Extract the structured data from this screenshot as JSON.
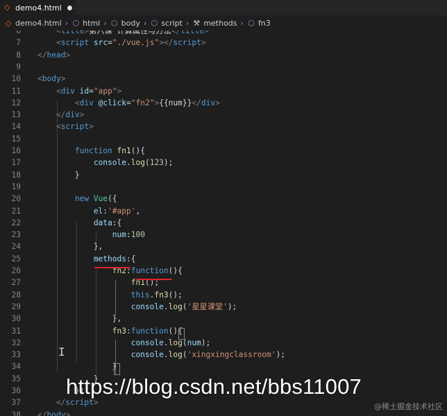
{
  "tab": {
    "filename": "demo4.html",
    "icon": "html-file-icon",
    "unsaved": true
  },
  "breadcrumb": [
    {
      "label": "demo4.html",
      "icon": "html-file-icon"
    },
    {
      "label": "html",
      "icon": "element-icon"
    },
    {
      "label": "body",
      "icon": "element-icon"
    },
    {
      "label": "script",
      "icon": "element-icon"
    },
    {
      "label": "methods",
      "icon": "wrench-icon"
    },
    {
      "label": "fn3",
      "icon": "element-icon"
    }
  ],
  "lines": [
    {
      "n": "6",
      "segs": [
        [
          "t-br",
          "    <"
        ],
        [
          "t-tag",
          "title"
        ],
        [
          "t-br",
          ">"
        ],
        [
          "t-plain",
          "第六课 计算属性与方法"
        ],
        [
          "t-br",
          "</"
        ],
        [
          "t-tag",
          "title"
        ],
        [
          "t-br",
          ">"
        ]
      ]
    },
    {
      "n": "7",
      "segs": [
        [
          "t-br",
          "    <"
        ],
        [
          "t-tag",
          "script"
        ],
        [
          "t-plain",
          " "
        ],
        [
          "t-attr",
          "src"
        ],
        [
          "t-plain",
          "="
        ],
        [
          "t-str",
          "\"./vue.js\""
        ],
        [
          "t-br",
          "></"
        ],
        [
          "t-tag",
          "script"
        ],
        [
          "t-br",
          ">"
        ]
      ]
    },
    {
      "n": "8",
      "segs": [
        [
          "t-br",
          "</"
        ],
        [
          "t-tag",
          "head"
        ],
        [
          "t-br",
          ">"
        ]
      ]
    },
    {
      "n": "9",
      "segs": []
    },
    {
      "n": "10",
      "segs": [
        [
          "t-br",
          "<"
        ],
        [
          "t-tag",
          "body"
        ],
        [
          "t-br",
          ">"
        ]
      ]
    },
    {
      "n": "11",
      "segs": [
        [
          "t-br",
          "    <"
        ],
        [
          "t-tag",
          "div"
        ],
        [
          "t-plain",
          " "
        ],
        [
          "t-attr",
          "id"
        ],
        [
          "t-plain",
          "="
        ],
        [
          "t-str",
          "\"app\""
        ],
        [
          "t-br",
          ">"
        ]
      ]
    },
    {
      "n": "12",
      "segs": [
        [
          "t-br",
          "        <"
        ],
        [
          "t-tag",
          "div"
        ],
        [
          "t-plain",
          " "
        ],
        [
          "t-attr",
          "@click"
        ],
        [
          "t-plain",
          "="
        ],
        [
          "t-str",
          "\"fn2\""
        ],
        [
          "t-br",
          ">"
        ],
        [
          "t-plain",
          "{{num}}"
        ],
        [
          "t-br",
          "</"
        ],
        [
          "t-tag",
          "div"
        ],
        [
          "t-br",
          ">"
        ]
      ]
    },
    {
      "n": "13",
      "segs": [
        [
          "t-br",
          "    </"
        ],
        [
          "t-tag",
          "div"
        ],
        [
          "t-br",
          ">"
        ]
      ]
    },
    {
      "n": "14",
      "segs": [
        [
          "t-br",
          "    <"
        ],
        [
          "t-tag",
          "script"
        ],
        [
          "t-br",
          ">"
        ]
      ]
    },
    {
      "n": "15",
      "segs": []
    },
    {
      "n": "16",
      "segs": [
        [
          "t-kw",
          "        function"
        ],
        [
          "t-plain",
          " "
        ],
        [
          "t-fn",
          "fn1"
        ],
        [
          "t-plain",
          "(){"
        ]
      ]
    },
    {
      "n": "17",
      "segs": [
        [
          "t-prop",
          "            console"
        ],
        [
          "t-plain",
          "."
        ],
        [
          "t-fn",
          "log"
        ],
        [
          "t-plain",
          "("
        ],
        [
          "t-num",
          "123"
        ],
        [
          "t-plain",
          ");"
        ]
      ]
    },
    {
      "n": "18",
      "segs": [
        [
          "t-plain",
          "        }"
        ]
      ]
    },
    {
      "n": "19",
      "segs": []
    },
    {
      "n": "20",
      "segs": [
        [
          "t-kw",
          "        new"
        ],
        [
          "t-plain",
          " "
        ],
        [
          "t-cls",
          "Vue"
        ],
        [
          "t-plain",
          "({"
        ]
      ]
    },
    {
      "n": "21",
      "segs": [
        [
          "t-prop",
          "            el"
        ],
        [
          "t-plain",
          ":"
        ],
        [
          "t-str",
          "'#app'"
        ],
        [
          "t-plain",
          ","
        ]
      ]
    },
    {
      "n": "22",
      "segs": [
        [
          "t-prop",
          "            data"
        ],
        [
          "t-plain",
          ":{"
        ]
      ]
    },
    {
      "n": "23",
      "segs": [
        [
          "t-prop",
          "                num"
        ],
        [
          "t-plain",
          ":"
        ],
        [
          "t-num",
          "100"
        ]
      ]
    },
    {
      "n": "24",
      "segs": [
        [
          "t-plain",
          "            },"
        ]
      ]
    },
    {
      "n": "25",
      "segs": [
        [
          "t-prop",
          "            methods"
        ],
        [
          "t-plain",
          ":{"
        ]
      ]
    },
    {
      "n": "26",
      "segs": [
        [
          "t-fn",
          "                fn2"
        ],
        [
          "t-plain",
          ":"
        ],
        [
          "t-kw",
          "function"
        ],
        [
          "t-plain",
          "(){"
        ]
      ]
    },
    {
      "n": "27",
      "segs": [
        [
          "t-fn",
          "                    fn1"
        ],
        [
          "t-plain",
          "();"
        ]
      ]
    },
    {
      "n": "28",
      "segs": [
        [
          "t-kw",
          "                    this"
        ],
        [
          "t-plain",
          "."
        ],
        [
          "t-fn",
          "fn3"
        ],
        [
          "t-plain",
          "();"
        ]
      ]
    },
    {
      "n": "29",
      "segs": [
        [
          "t-prop",
          "                    console"
        ],
        [
          "t-plain",
          "."
        ],
        [
          "t-fn",
          "log"
        ],
        [
          "t-plain",
          "("
        ],
        [
          "t-str",
          "'星星课堂'"
        ],
        [
          "t-plain",
          ");"
        ]
      ]
    },
    {
      "n": "30",
      "segs": [
        [
          "t-plain",
          "                },"
        ]
      ]
    },
    {
      "n": "31",
      "segs": [
        [
          "t-fn",
          "                fn3"
        ],
        [
          "t-plain",
          ":"
        ],
        [
          "t-kw",
          "function"
        ],
        [
          "t-plain",
          "(){"
        ]
      ]
    },
    {
      "n": "32",
      "segs": [
        [
          "t-prop",
          "                    console"
        ],
        [
          "t-plain",
          "."
        ],
        [
          "t-fn",
          "log"
        ],
        [
          "t-plain",
          "("
        ],
        [
          "t-prop",
          "num"
        ],
        [
          "t-plain",
          ");"
        ]
      ]
    },
    {
      "n": "33",
      "segs": [
        [
          "t-prop",
          "                    console"
        ],
        [
          "t-plain",
          "."
        ],
        [
          "t-fn",
          "log"
        ],
        [
          "t-plain",
          "("
        ],
        [
          "t-str",
          "'xingxingclassroom'"
        ],
        [
          "t-plain",
          ");"
        ]
      ]
    },
    {
      "n": "34",
      "segs": [
        [
          "t-plain",
          "                }"
        ]
      ]
    },
    {
      "n": "35",
      "segs": [
        [
          "t-plain",
          "            }"
        ]
      ]
    },
    {
      "n": "36",
      "segs": [
        [
          "t-plain",
          "        })"
        ]
      ]
    },
    {
      "n": "37",
      "segs": [
        [
          "t-br",
          "    </"
        ],
        [
          "t-tag",
          "script"
        ],
        [
          "t-br",
          ">"
        ]
      ]
    },
    {
      "n": "38",
      "segs": [
        [
          "t-br",
          "</"
        ],
        [
          "t-tag",
          "body"
        ],
        [
          "t-br",
          ">"
        ]
      ]
    }
  ],
  "watermark": {
    "url": "https://blog.csdn.net/bbs11007",
    "small": "@稀土掘金技术社区"
  },
  "colors": {
    "background": "#1e1e1e",
    "annotation_red": "#e0242a"
  }
}
